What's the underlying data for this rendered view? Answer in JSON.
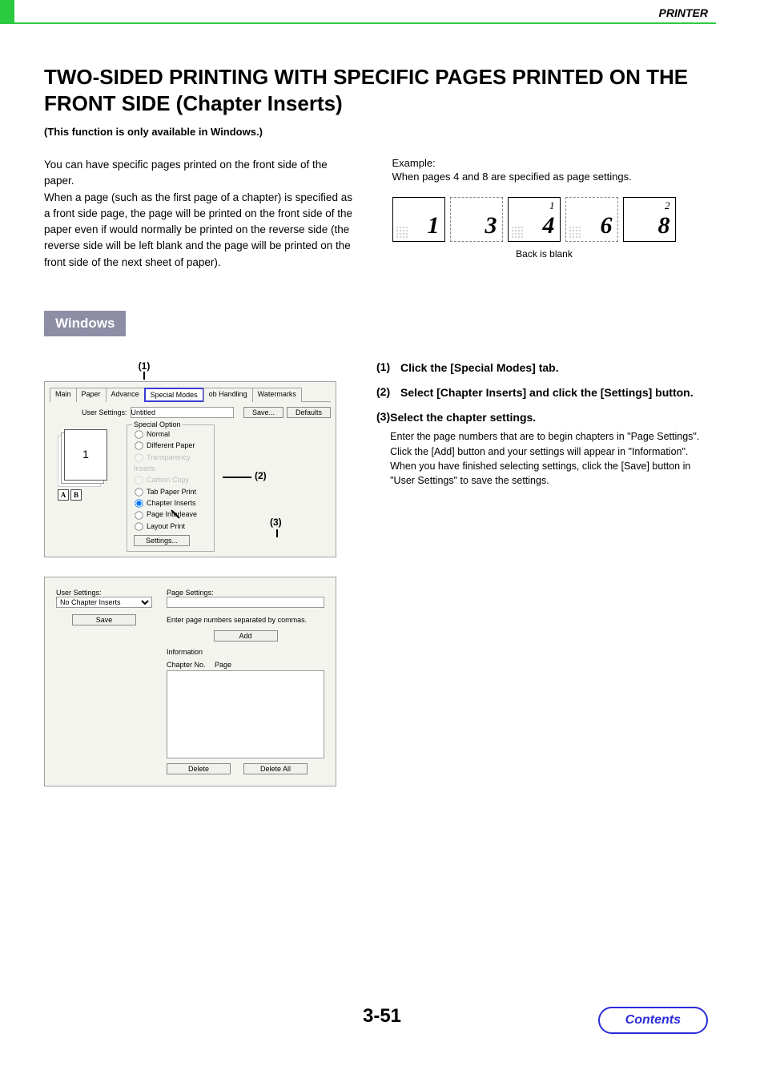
{
  "header": {
    "section": "PRINTER"
  },
  "title": "TWO-SIDED PRINTING WITH SPECIFIC PAGES PRINTED ON THE FRONT SIDE (Chapter Inserts)",
  "subnote": "(This function is only available in Windows.)",
  "intro": "You can have specific pages printed on the front side of the paper.\nWhen a page (such as the first page of a chapter) is specified as a front side page, the page will be printed on the front side of the paper even if would normally be printed on the reverse side (the reverse side will be left blank and the page will be printed on the front side of the next sheet of paper).",
  "example": {
    "label": "Example:",
    "desc": "When pages 4 and 8 are specified as page settings.",
    "pages": [
      {
        "corner": "",
        "big": "1",
        "dots": true
      },
      {
        "corner": "",
        "big": "3",
        "dots": false,
        "dashed": true
      },
      {
        "corner": "1",
        "big": "4",
        "dots": true
      },
      {
        "corner": "",
        "big": "6",
        "dots": true,
        "dashed": true
      },
      {
        "corner": "2",
        "big": "8",
        "dots": false
      }
    ],
    "back_blank": "Back is blank"
  },
  "os_badge": "Windows",
  "callouts": {
    "c1": "(1)",
    "c2": "(2)",
    "c3": "(3)"
  },
  "dialog1": {
    "tabs": [
      "Main",
      "Paper",
      "Advance",
      "Special Modes",
      "ob Handling",
      "Watermarks"
    ],
    "user_settings_label": "User Settings:",
    "user_settings_value": "Untitled",
    "save_btn": "Save...",
    "defaults_btn": "Defaults",
    "special_option_legend": "Special Option",
    "radios": [
      {
        "label": "Normal",
        "grey": false
      },
      {
        "label": "Different Paper",
        "grey": false
      },
      {
        "label": "Transparency Inserts",
        "grey": true
      },
      {
        "label": "Carbon Copy",
        "grey": true
      },
      {
        "label": "Tab Paper Print",
        "grey": false
      },
      {
        "label": "Chapter Inserts",
        "grey": false,
        "checked": true
      },
      {
        "label": "Page Interleave",
        "grey": false
      },
      {
        "label": "Layout Print",
        "grey": false
      }
    ],
    "settings_btn": "Settings..."
  },
  "dialog2": {
    "user_settings_label": "User Settings:",
    "dropdown": "No Chapter Inserts",
    "save_btn": "Save",
    "page_settings_label": "Page Settings:",
    "hint": "Enter page numbers separated by commas.",
    "add_btn": "Add",
    "info_label": "Information",
    "chapter_no": "Chapter No.",
    "page_col": "Page",
    "delete_btn": "Delete",
    "delete_all_btn": "Delete All"
  },
  "steps": [
    {
      "num": "(1)",
      "title": "Click the [Special Modes] tab."
    },
    {
      "num": "(2)",
      "title": "Select [Chapter Inserts] and click the [Settings] button."
    },
    {
      "num": "(3)",
      "title": "Select the chapter settings.",
      "body": "Enter the page numbers that are to begin chapters in \"Page Settings\". Click the [Add] button and your settings will appear in \"Information\". When you have finished selecting settings, click the [Save] button in \"User Settings\" to save the settings."
    }
  ],
  "page_number": "3-51",
  "contents_btn": "Contents"
}
